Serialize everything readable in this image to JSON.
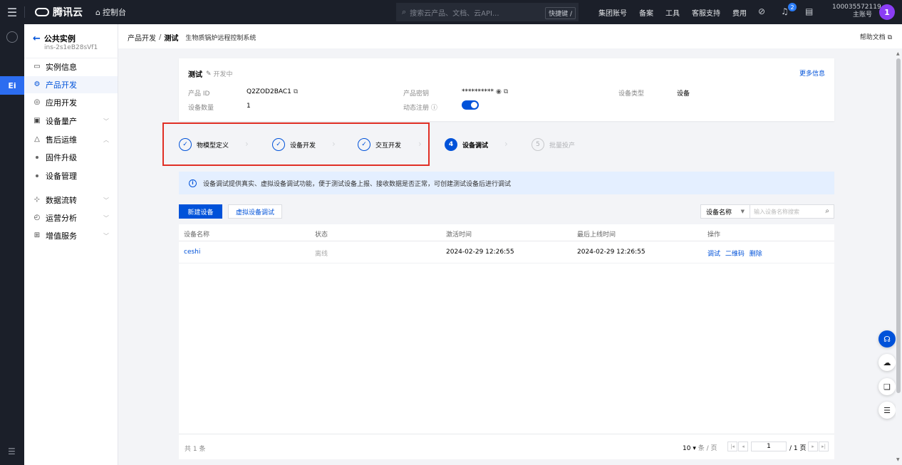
{
  "topbar": {
    "brand": "腾讯云",
    "console": "控制台",
    "search_placeholder": "搜索云产品、文档、云API...",
    "shortcut": "快捷键 /",
    "nav": [
      "集团账号",
      "备案",
      "工具",
      "客服支持",
      "费用"
    ],
    "notification_count": "2",
    "account_id": "100035572119",
    "account_role": "主账号",
    "avatar": "1"
  },
  "sidebar": {
    "back_label": "公共实例",
    "instance_id": "ins-2s1eB28sVf1",
    "items": [
      {
        "label": "实例信息",
        "icon": "monitor-icon"
      },
      {
        "label": "产品开发",
        "icon": "gear-icon"
      },
      {
        "label": "应用开发",
        "icon": "app-icon"
      },
      {
        "label": "设备量产",
        "icon": "device-icon"
      },
      {
        "label": "售后运维",
        "icon": "triangle-icon"
      },
      {
        "label": "固件升级",
        "icon": "dot"
      },
      {
        "label": "设备管理",
        "icon": "dot"
      },
      {
        "label": "数据流转",
        "icon": "flow-icon"
      },
      {
        "label": "运营分析",
        "icon": "chart-icon"
      },
      {
        "label": "增值服务",
        "icon": "service-icon"
      }
    ]
  },
  "breadcrumb": {
    "parent": "产品开发",
    "separator": "/",
    "current": "测试",
    "project": "生物质锅炉远程控制系统"
  },
  "help_docs": "帮助文档 ⧉",
  "card": {
    "title": "测试",
    "status": "开发中",
    "more": "更多信息",
    "product_id_label": "产品 ID",
    "product_id": "Q2ZOD2BAC1",
    "device_count_label": "设备数量",
    "device_count": "1",
    "secret_label": "产品密钥",
    "secret": "**********",
    "dynamic_reg_label": "动态注册 ⓘ",
    "device_type_label": "设备类型",
    "device_type": "设备"
  },
  "steps": [
    {
      "num": "✓",
      "label": "物模型定义",
      "state": "done"
    },
    {
      "num": "✓",
      "label": "设备开发",
      "state": "done"
    },
    {
      "num": "✓",
      "label": "交互开发",
      "state": "done"
    },
    {
      "num": "4",
      "label": "设备调试",
      "state": "active"
    },
    {
      "num": "5",
      "label": "批量投产",
      "state": "pending"
    }
  ],
  "banner": "设备调试提供真实、虚拟设备调试功能，便于测试设备上报、接收数据是否正常，可创建测试设备后进行调试",
  "toolbar": {
    "new_device": "新建设备",
    "virtual_debug": "虚拟设备调试",
    "filter_field": "设备名称",
    "search_placeholder": "输入设备名称搜索"
  },
  "table": {
    "headers": [
      "设备名称",
      "状态",
      "激活时间",
      "最后上线时间",
      "操作"
    ],
    "rows": [
      {
        "name": "ceshi",
        "status": "离线",
        "activated": "2024-02-29 12:26:55",
        "last_online": "2024-02-29 12:26:55",
        "ops": [
          "调试",
          "二维码",
          "删除"
        ]
      }
    ]
  },
  "pagination": {
    "total": "共 1 条",
    "page_size": "10",
    "page_size_unit": "条 / 页",
    "page": "1",
    "of_pages": "/ 1 页"
  },
  "colors": {
    "primary": "#0052d9",
    "highlight_border": "#e02f25",
    "topbar_bg": "#1b1f29"
  }
}
